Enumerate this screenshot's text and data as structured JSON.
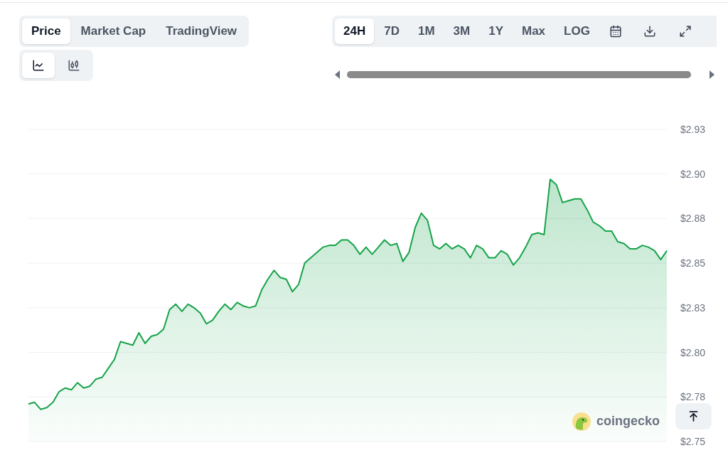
{
  "tabs": [
    {
      "label": "Price",
      "selected": true
    },
    {
      "label": "Market Cap",
      "selected": false
    },
    {
      "label": "TradingView",
      "selected": false
    }
  ],
  "chart_types": [
    {
      "kind": "line",
      "selected": true
    },
    {
      "kind": "candlestick",
      "selected": false
    }
  ],
  "ranges": [
    {
      "label": "24H",
      "selected": true
    },
    {
      "label": "7D",
      "selected": false
    },
    {
      "label": "1M",
      "selected": false
    },
    {
      "label": "3M",
      "selected": false
    },
    {
      "label": "1Y",
      "selected": false
    },
    {
      "label": "Max",
      "selected": false
    },
    {
      "label": "LOG",
      "selected": false
    }
  ],
  "chart_logo": "coingecko",
  "chart_data": {
    "type": "area",
    "grid": true,
    "ylim": [
      2.75,
      2.925
    ],
    "yticks": [
      {
        "value": 2.75,
        "label": "$2.75"
      },
      {
        "value": 2.775,
        "label": "$2.78"
      },
      {
        "value": 2.8,
        "label": "$2.80"
      },
      {
        "value": 2.825,
        "label": "$2.83"
      },
      {
        "value": 2.85,
        "label": "$2.85"
      },
      {
        "value": 2.875,
        "label": "$2.88"
      },
      {
        "value": 2.9,
        "label": "$2.90"
      },
      {
        "value": 2.925,
        "label": "$2.93"
      }
    ],
    "series": [
      {
        "color": "#16a34a",
        "values": [
          2.771,
          2.772,
          2.768,
          2.769,
          2.772,
          2.778,
          2.78,
          2.779,
          2.783,
          2.78,
          2.781,
          2.785,
          2.786,
          2.791,
          2.796,
          2.806,
          2.805,
          2.804,
          2.811,
          2.805,
          2.809,
          2.81,
          2.813,
          2.824,
          2.827,
          2.823,
          2.827,
          2.825,
          2.822,
          2.816,
          2.818,
          2.823,
          2.827,
          2.824,
          2.828,
          2.826,
          2.825,
          2.826,
          2.835,
          2.841,
          2.846,
          2.842,
          2.841,
          2.834,
          2.838,
          2.85,
          2.853,
          2.856,
          2.859,
          2.86,
          2.86,
          2.863,
          2.863,
          2.86,
          2.855,
          2.859,
          2.855,
          2.859,
          2.863,
          2.86,
          2.861,
          2.851,
          2.856,
          2.87,
          2.878,
          2.874,
          2.86,
          2.858,
          2.861,
          2.858,
          2.86,
          2.858,
          2.853,
          2.86,
          2.858,
          2.853,
          2.853,
          2.857,
          2.855,
          2.849,
          2.853,
          2.859,
          2.866,
          2.867,
          2.866,
          2.897,
          2.894,
          2.884,
          2.885,
          2.886,
          2.886,
          2.88,
          2.873,
          2.871,
          2.868,
          2.868,
          2.862,
          2.861,
          2.858,
          2.858,
          2.86,
          2.859,
          2.857,
          2.852,
          2.857
        ]
      }
    ]
  }
}
